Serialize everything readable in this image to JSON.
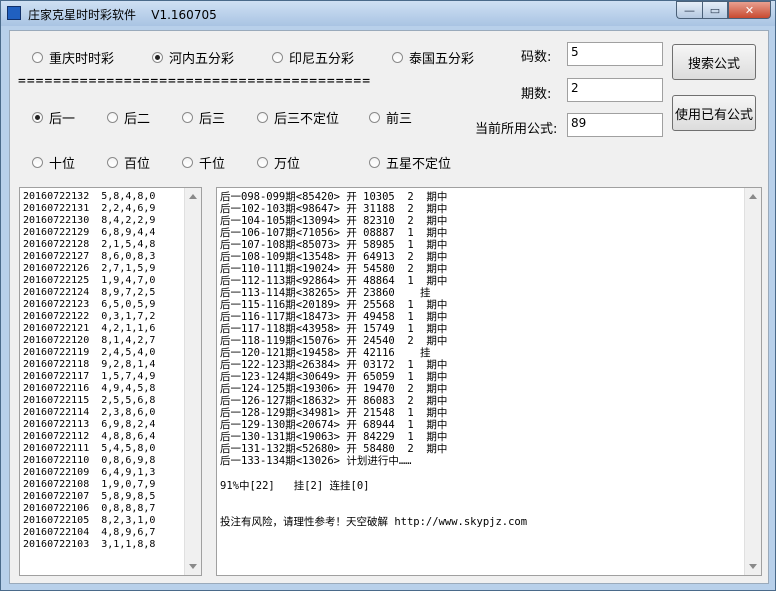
{
  "window": {
    "title": "庄家克星时时彩软件    V1.160705",
    "buttons": {
      "minimize": "—",
      "maximize": "▭",
      "close": "✕"
    }
  },
  "lottery_types": [
    {
      "label": "重庆时时彩",
      "selected": false
    },
    {
      "label": "河内五分彩",
      "selected": true
    },
    {
      "label": "印尼五分彩",
      "selected": false
    },
    {
      "label": "泰国五分彩",
      "selected": false
    }
  ],
  "separator": "========================================",
  "position_row1": [
    {
      "label": "后一",
      "selected": true
    },
    {
      "label": "后二",
      "selected": false
    },
    {
      "label": "后三",
      "selected": false
    },
    {
      "label": "后三不定位",
      "selected": false
    },
    {
      "label": "前三",
      "selected": false
    }
  ],
  "position_row2": [
    {
      "label": "十位",
      "selected": false
    },
    {
      "label": "百位",
      "selected": false
    },
    {
      "label": "千位",
      "selected": false
    },
    {
      "label": "万位",
      "selected": false
    },
    {
      "label": "五星不定位",
      "selected": false
    }
  ],
  "fields": {
    "code_count": {
      "label": "码数:",
      "value": "5"
    },
    "period_count": {
      "label": "期数:",
      "value": "2"
    },
    "current_formula": {
      "label": "当前所用公式:",
      "value": "89"
    }
  },
  "actions": {
    "search_formula": "搜索公式",
    "use_existing_formula": "使用已有公式"
  },
  "history": [
    "20160722132  5,8,4,8,0",
    "20160722131  2,2,4,6,9",
    "20160722130  8,4,2,2,9",
    "20160722129  6,8,9,4,4",
    "20160722128  2,1,5,4,8",
    "20160722127  8,6,0,8,3",
    "20160722126  2,7,1,5,9",
    "20160722125  1,9,4,7,0",
    "20160722124  8,9,7,2,5",
    "20160722123  6,5,0,5,9",
    "20160722122  0,3,1,7,2",
    "20160722121  4,2,1,1,6",
    "20160722120  8,1,4,2,7",
    "20160722119  2,4,5,4,0",
    "20160722118  9,2,8,1,4",
    "20160722117  1,5,7,4,9",
    "20160722116  4,9,4,5,8",
    "20160722115  2,5,5,6,8",
    "20160722114  2,3,8,6,0",
    "20160722113  6,9,8,2,4",
    "20160722112  4,8,8,6,4",
    "20160722111  5,4,5,8,0",
    "20160722110  0,8,6,9,8",
    "20160722109  6,4,9,1,3",
    "20160722108  1,9,0,7,9",
    "20160722107  5,8,9,8,5",
    "20160722106  0,8,8,8,7",
    "20160722105  8,2,3,1,0",
    "20160722104  4,8,9,6,7",
    "20160722103  3,1,1,8,8"
  ],
  "plan_results": [
    "后一098-099期<85420> 开 10305  2  期中",
    "后一102-103期<98647> 开 31188  2  期中",
    "后一104-105期<13094> 开 82310  2  期中",
    "后一106-107期<71056> 开 08887  1  期中",
    "后一107-108期<85073> 开 58985  1  期中",
    "后一108-109期<13548> 开 64913  2  期中",
    "后一110-111期<19024> 开 54580  2  期中",
    "后一112-113期<92864> 开 48864  1  期中",
    "后一113-114期<38265> 开 23860    挂",
    "后一115-116期<20189> 开 25568  1  期中",
    "后一116-117期<18473> 开 49458  1  期中",
    "后一117-118期<43958> 开 15749  1  期中",
    "后一118-119期<15076> 开 24540  2  期中",
    "后一120-121期<19458> 开 42116    挂",
    "后一122-123期<26384> 开 03172  1  期中",
    "后一123-124期<30649> 开 65059  1  期中",
    "后一124-125期<19306> 开 19470  2  期中",
    "后一126-127期<18632> 开 86083  2  期中",
    "后一128-129期<34981> 开 21548  1  期中",
    "后一129-130期<20674> 开 68944  1  期中",
    "后一130-131期<19063> 开 84229  1  期中",
    "后一131-132期<52680> 开 58480  2  期中",
    "后一133-134期<13026> 计划进行中……"
  ],
  "summary": "91%中[22]   挂[2] 连挂[0]",
  "disclaimer": "投注有风险，请理性参考！天空破解 http://www.skypjz.com"
}
